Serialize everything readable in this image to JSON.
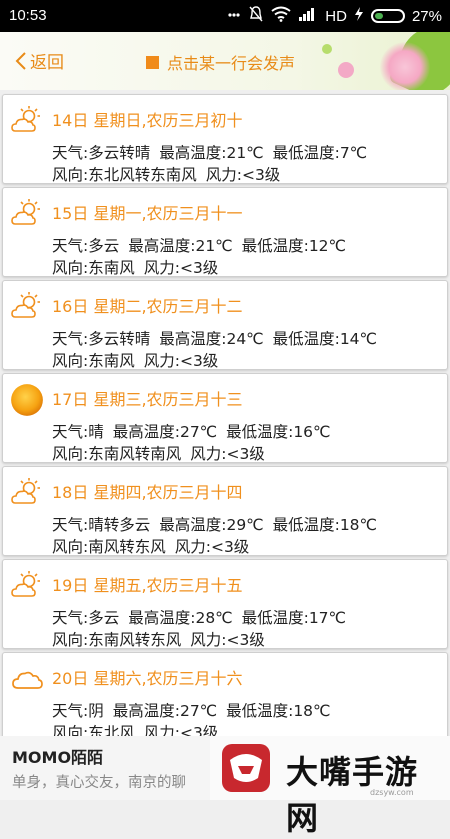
{
  "status_bar": {
    "time": "10:53",
    "network": "HD",
    "battery": "27%"
  },
  "header": {
    "back_label": "返回",
    "hint": "点击某一行会发声"
  },
  "days": [
    {
      "icon": "partly-cloudy-icon",
      "title": "14日  星期日,农历三月初十",
      "weather": "天气:多云转晴",
      "high": "最高温度:21℃",
      "low": "最低温度:7℃",
      "wind": "风向:东北风转东南风",
      "power": "风力:<3级"
    },
    {
      "icon": "partly-cloudy-icon",
      "title": "15日  星期一,农历三月十一",
      "weather": "天气:多云",
      "high": "最高温度:21℃",
      "low": "最低温度:12℃",
      "wind": "风向:东南风",
      "power": "风力:<3级"
    },
    {
      "icon": "partly-cloudy-icon",
      "title": "16日  星期二,农历三月十二",
      "weather": "天气:多云转晴",
      "high": "最高温度:24℃",
      "low": "最低温度:14℃",
      "wind": "风向:东南风",
      "power": "风力:<3级"
    },
    {
      "icon": "sun-icon",
      "title": "17日  星期三,农历三月十三",
      "weather": "天气:晴",
      "high": "最高温度:27℃",
      "low": "最低温度:16℃",
      "wind": "风向:东南风转南风",
      "power": "风力:<3级"
    },
    {
      "icon": "partly-cloudy-icon",
      "title": "18日  星期四,农历三月十四",
      "weather": "天气:晴转多云",
      "high": "最高温度:29℃",
      "low": "最低温度:18℃",
      "wind": "风向:南风转东风",
      "power": "风力:<3级"
    },
    {
      "icon": "partly-cloudy-icon",
      "title": "19日  星期五,农历三月十五",
      "weather": "天气:多云",
      "high": "最高温度:28℃",
      "low": "最低温度:17℃",
      "wind": "风向:东南风转东风",
      "power": "风力:<3级"
    },
    {
      "icon": "cloud-icon",
      "title": "20日  星期六,农历三月十六",
      "weather": "天气:阴",
      "high": "最高温度:27℃",
      "low": "最低温度:18℃",
      "wind": "风向:东北风",
      "power": "风力:<3级"
    }
  ],
  "ad": {
    "title": "MOMO陌陌",
    "subtitle": "单身，真心交友，南京的聊",
    "brand": "大嘴手游网",
    "url": "dzsyw.com"
  },
  "colors": {
    "accent": "#f0901e",
    "card_border": "#cfcfcf"
  }
}
